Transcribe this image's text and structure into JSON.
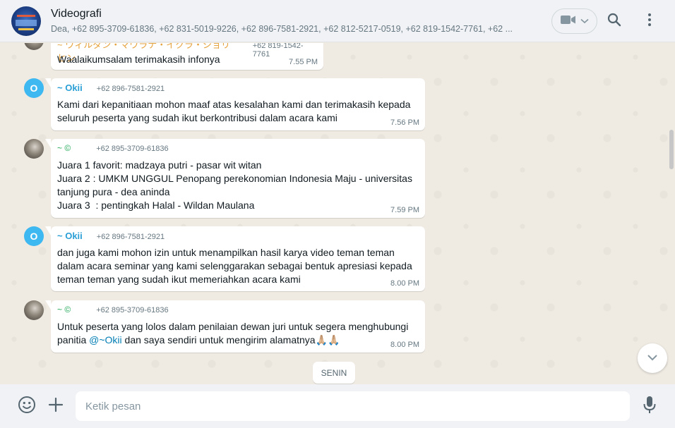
{
  "header": {
    "title": "Videografi",
    "participants": "Dea, +62 895-3709-61836, +62 831-5019-9226, +62 896-7581-2921, +62 812-5217-0519, +62 819-1542-7761, +62 ..."
  },
  "icons": {
    "video": "video-camera-icon",
    "dropdown": "chevron-down-icon",
    "search": "search-icon",
    "menu": "kebab-menu-icon",
    "emoji": "emoji-icon",
    "attach": "plus-icon",
    "mic": "microphone-icon",
    "scroll_down": "chevron-down-icon"
  },
  "colors": {
    "okii_name": "#2a9fd6",
    "copyright_name": "#1fa855",
    "mention": "#027eb5"
  },
  "messages": [
    {
      "id": "m0",
      "sender": "~ ウィルダン・マウラナ・イクラ・ショリヒン",
      "phone": "+62 819-1542-7761",
      "text": "Waalaikumsalam terimakasih infonya",
      "time": "7.55 PM"
    },
    {
      "id": "m1",
      "avatar_letter": "O",
      "sender": "~ Okii",
      "phone": "+62 896-7581-2921",
      "text": "Kami dari kepanitiaan mohon maaf atas kesalahan kami dan terimakasih kepada seluruh peserta yang sudah ikut berkontribusi dalam acara kami",
      "time": "7.56 PM"
    },
    {
      "id": "m2",
      "sender": "~ ©",
      "phone": "+62 895-3709-61836",
      "text": "Juara 1 favorit: madzaya putri - pasar wit witan\nJuara 2 : UMKM UNGGUL Penopang perekonomian Indonesia Maju - universitas tanjung pura - dea aninda\nJuara 3  : pentingkah Halal - Wildan Maulana",
      "time": "7.59 PM"
    },
    {
      "id": "m3",
      "avatar_letter": "O",
      "sender": "~ Okii",
      "phone": "+62 896-7581-2921",
      "text": "dan juga kami mohon izin untuk menampilkan hasil karya video teman teman dalam acara seminar yang kami selenggarakan sebagai bentuk apresiasi kepada teman teman yang sudah ikut memeriahkan acara kami",
      "time": "8.00 PM"
    },
    {
      "id": "m4",
      "sender": "~ ©",
      "phone": "+62 895-3709-61836",
      "text_before": "Untuk peserta yang lolos dalam penilaian dewan juri untuk segera menghubungi panitia ",
      "mention": "@~Okii",
      "text_after": " dan saya sendiri untuk mengirim alamatnya",
      "emoji": "🙏🏼🙏🏼",
      "time": "8.00 PM"
    }
  ],
  "day_divider": "SENIN",
  "composer": {
    "placeholder": "Ketik pesan"
  }
}
